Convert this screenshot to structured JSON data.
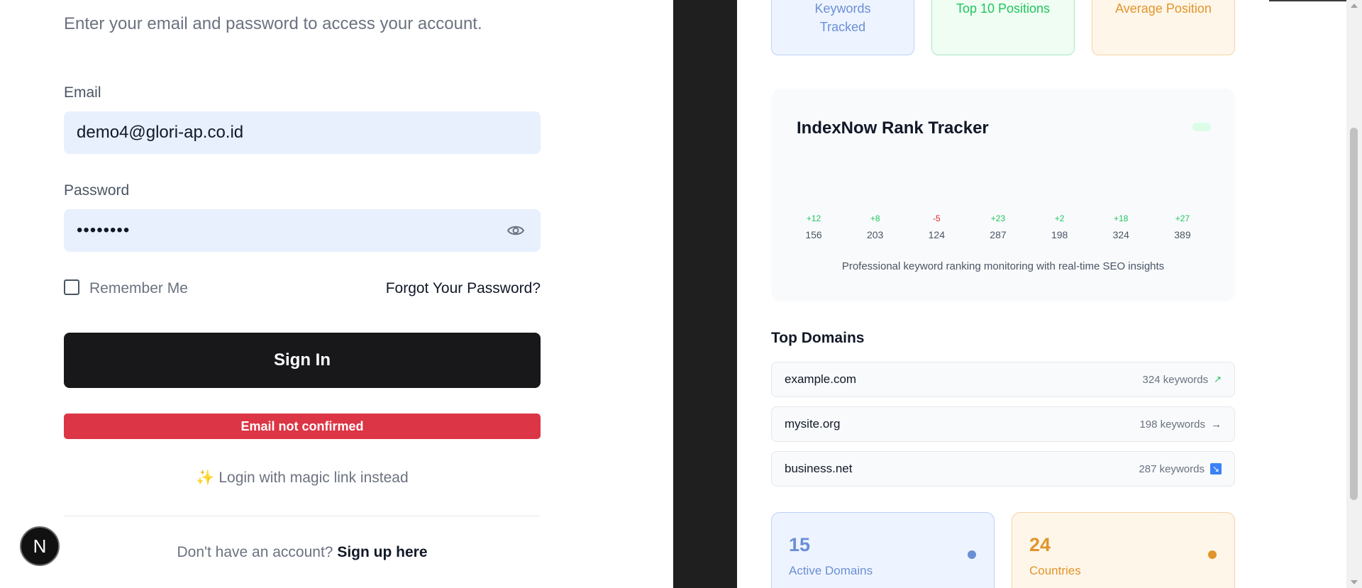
{
  "login": {
    "subtitle": "Enter your email and password to access your account.",
    "email_label": "Email",
    "email_value": "demo4@glori-ap.co.id",
    "password_label": "Password",
    "password_value": "••••••••",
    "remember_label": "Remember Me",
    "forgot_label": "Forgot Your Password?",
    "signin_label": "Sign In",
    "error_message": "Email not confirmed",
    "magic_icon": "✨",
    "magic_label": "Login with magic link instead",
    "signup_prompt": "Don't have an account?",
    "signup_link": "Sign up here"
  },
  "badge": {
    "letter": "N"
  },
  "stats_top": [
    {
      "label_line1": "Keywords",
      "label_line2": "Tracked",
      "color": "#6b8fd4"
    },
    {
      "label_line1": "Top 10 Positions",
      "label_line2": "",
      "color": "#22c55e"
    },
    {
      "label_line1": "Average Position",
      "label_line2": "",
      "color": "#e0952b"
    }
  ],
  "tracker": {
    "title": "IndexNow Rank Tracker",
    "changes": [
      "+12",
      "+8",
      "-5",
      "+23",
      "+2",
      "+18",
      "+27"
    ],
    "values": [
      "156",
      "203",
      "124",
      "287",
      "198",
      "324",
      "389"
    ],
    "description": "Professional keyword ranking monitoring with real-time SEO insights"
  },
  "domains": {
    "heading": "Top Domains",
    "items": [
      {
        "name": "example.com",
        "keywords": "324 keywords",
        "trend": "↗"
      },
      {
        "name": "mysite.org",
        "keywords": "198 keywords",
        "trend": "→"
      },
      {
        "name": "business.net",
        "keywords": "287 keywords",
        "trend": "↘"
      }
    ]
  },
  "bottom_stats": [
    {
      "number": "15",
      "label": "Active Domains",
      "color": "#6b8fd4"
    },
    {
      "number": "24",
      "label": "Countries",
      "color": "#e0952b"
    }
  ]
}
